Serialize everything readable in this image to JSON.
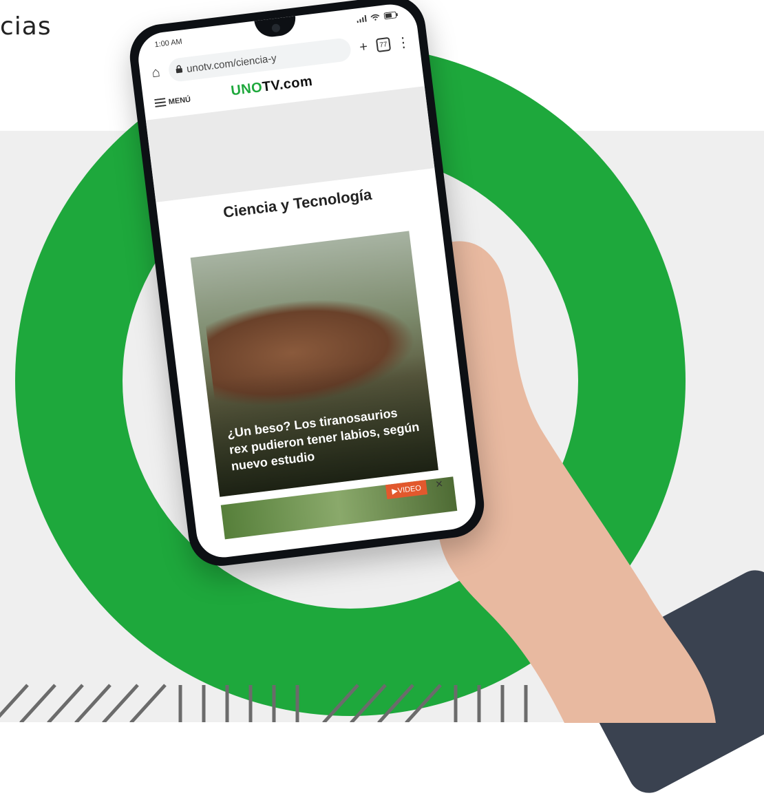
{
  "page": {
    "header_text": "cias"
  },
  "colors": {
    "ring": "#1ea83c",
    "panel": "#efefef",
    "video_badge": "#e2582d"
  },
  "phone": {
    "status_time": "1:00 AM",
    "url": "unotv.com/ciencia-y",
    "tab_count": "77",
    "menu_label": "MENÚ",
    "logo_uno": "UNO",
    "logo_tv": "TV.com",
    "section_title": "Ciencia y Tecnología",
    "card_title": "¿Un beso? Los tiranosaurios rex pudieron tener labios, según nuevo estudio",
    "video_badge": "▶VIDEO",
    "close_label": "×",
    "icons": [
      "home-icon",
      "lock-icon",
      "plus-icon",
      "tabs-icon",
      "more-vert-icon",
      "hamburger-icon",
      "signal-icon",
      "wifi-icon",
      "battery-icon"
    ]
  }
}
